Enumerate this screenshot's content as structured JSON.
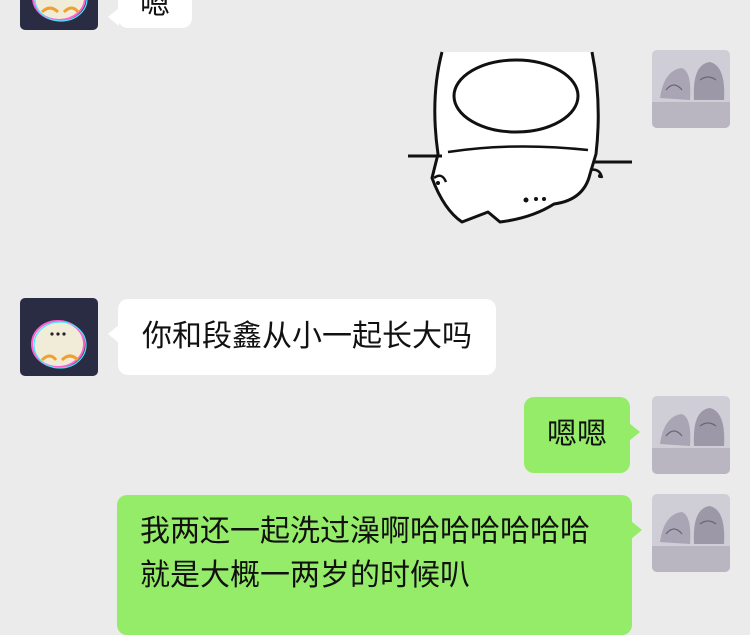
{
  "chat": {
    "messages": [
      {
        "sender": "friend",
        "type": "text",
        "text": "嗯"
      },
      {
        "sender": "me",
        "type": "sticker",
        "sticker": "cartoon-cat-back-sticker"
      },
      {
        "sender": "friend",
        "type": "text",
        "text": "你和段鑫从小一起长大吗"
      },
      {
        "sender": "me",
        "type": "text",
        "text": "嗯嗯"
      },
      {
        "sender": "me",
        "type": "text",
        "text": "我两还一起洗过澡啊哈哈哈哈哈哈就是大概一两岁的时候叭"
      }
    ]
  },
  "colors": {
    "background": "#ebebeb",
    "friend_bubble": "#ffffff",
    "my_bubble": "#95ec69"
  }
}
